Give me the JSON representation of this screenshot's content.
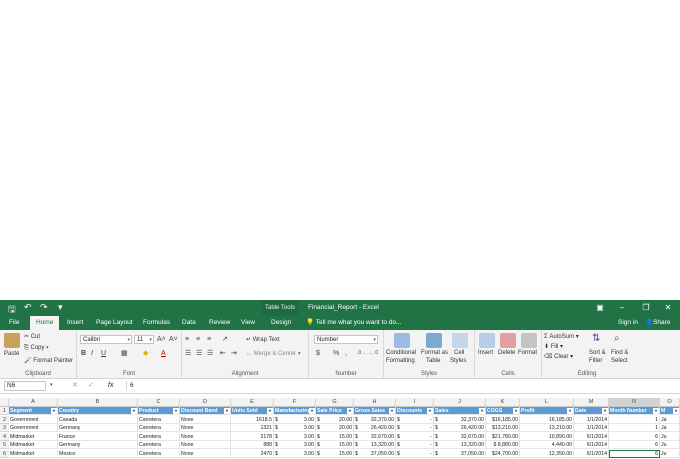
{
  "title_bar": {
    "table_tools": "Table Tools",
    "window_title": "Financial_Report - Excel"
  },
  "tabs": [
    "File",
    "Home",
    "Insert",
    "Page Layout",
    "Formulas",
    "Data",
    "Review",
    "View",
    "Design"
  ],
  "active_tab": "Home",
  "tell_me": "Tell me what you want to do...",
  "sign_in": "Sign in",
  "share": "Share",
  "ribbon": {
    "clipboard": {
      "paste": "Paste",
      "cut": "Cut",
      "copy": "Copy",
      "format_painter": "Format Painter",
      "label": "Clipboard"
    },
    "font": {
      "name": "Calibri",
      "size": "11",
      "bold": "B",
      "italic": "I",
      "underline": "U",
      "label": "Font"
    },
    "alignment": {
      "wrap": "Wrap Text",
      "merge": "Merge & Center",
      "label": "Alignment"
    },
    "number": {
      "format": "Number",
      "currency": "$",
      "percent": "%",
      "comma": ",",
      "label": "Number"
    },
    "styles": {
      "conditional": "Conditional",
      "conditional2": "Formatting",
      "table": "Format as",
      "table2": "Table",
      "cell": "Cell",
      "cell2": "Styles",
      "label": "Styles"
    },
    "cells": {
      "insert": "Insert",
      "delete": "Delete",
      "format": "Format",
      "label": "Cells"
    },
    "editing": {
      "autosum": "AutoSum",
      "fill": "Fill",
      "clear": "Clear",
      "sort": "Sort &",
      "sort2": "Filter",
      "find": "Find &",
      "find2": "Select",
      "label": "Editing"
    }
  },
  "formula_bar": {
    "name_box": "N6",
    "fx": "fx",
    "value": "6"
  },
  "columns": [
    "A",
    "B",
    "C",
    "D",
    "E",
    "F",
    "G",
    "H",
    "I",
    "J",
    "K",
    "L",
    "M",
    "N",
    "O"
  ],
  "headers": [
    "Segment",
    "Country",
    "Product",
    "Discount Band",
    "Units Sold",
    "Manufacturing",
    "Sale Price",
    "Gross Sales",
    "Discounts",
    "Sales",
    "COGS",
    "Profit",
    "Date",
    "Month Number",
    "M"
  ],
  "rows": [
    {
      "num": "2",
      "Segment": "Government",
      "Country": "Canada",
      "Product": "Carretera",
      "Band": "None",
      "Units": "1618.5",
      "Mfg": "3.00",
      "Price": "20.00",
      "Gross": "32,370.00",
      "Disc": "-",
      "Sales": "32,370.00",
      "COGS": "$16,185.00",
      "Profit": "16,185.00",
      "Date": "1/1/2014",
      "Month": "1",
      "M": "Ja"
    },
    {
      "num": "3",
      "Segment": "Government",
      "Country": "Germany",
      "Product": "Carretera",
      "Band": "None",
      "Units": "1321",
      "Mfg": "3.00",
      "Price": "20.00",
      "Gross": "26,420.00",
      "Disc": "-",
      "Sales": "26,420.00",
      "COGS": "$13,210.00",
      "Profit": "13,210.00",
      "Date": "1/1/2014",
      "Month": "1",
      "M": "Ja"
    },
    {
      "num": "4",
      "Segment": "Midmarket",
      "Country": "France",
      "Product": "Carretera",
      "Band": "None",
      "Units": "2178",
      "Mfg": "3.00",
      "Price": "15.00",
      "Gross": "32,670.00",
      "Disc": "-",
      "Sales": "32,670.00",
      "COGS": "$21,780.00",
      "Profit": "10,890.00",
      "Date": "6/1/2014",
      "Month": "6",
      "M": "Ju"
    },
    {
      "num": "5",
      "Segment": "Midmarket",
      "Country": "Germany",
      "Product": "Carretera",
      "Band": "None",
      "Units": "888",
      "Mfg": "3.00",
      "Price": "15.00",
      "Gross": "13,320.00",
      "Disc": "-",
      "Sales": "13,320.00",
      "COGS": "$ 8,880.00",
      "Profit": "4,440.00",
      "Date": "6/1/2014",
      "Month": "6",
      "M": "Ju"
    },
    {
      "num": "6",
      "Segment": "Midmarket",
      "Country": "Mexico",
      "Product": "Carretera",
      "Band": "None",
      "Units": "2470",
      "Mfg": "3.00",
      "Price": "15.00",
      "Gross": "37,050.00",
      "Disc": "-",
      "Sales": "37,050.00",
      "COGS": "$24,700.00",
      "Profit": "12,350.00",
      "Date": "6/1/2014",
      "Month": "6",
      "M": "Ju"
    }
  ],
  "currency_symbol": "$",
  "selected_cell": "N6",
  "colors": {
    "excel_green": "#217346",
    "table_header": "#5b9bd5"
  },
  "icons": [
    "save-icon",
    "undo-icon",
    "redo-icon",
    "paste-icon",
    "cut-icon",
    "copy-icon",
    "format-painter-icon",
    "conditional-formatting-icon",
    "format-as-table-icon",
    "cell-styles-icon",
    "insert-cells-icon",
    "delete-cells-icon",
    "format-cells-icon",
    "autosum-icon",
    "fill-icon",
    "clear-icon",
    "sort-filter-icon",
    "find-select-icon"
  ]
}
